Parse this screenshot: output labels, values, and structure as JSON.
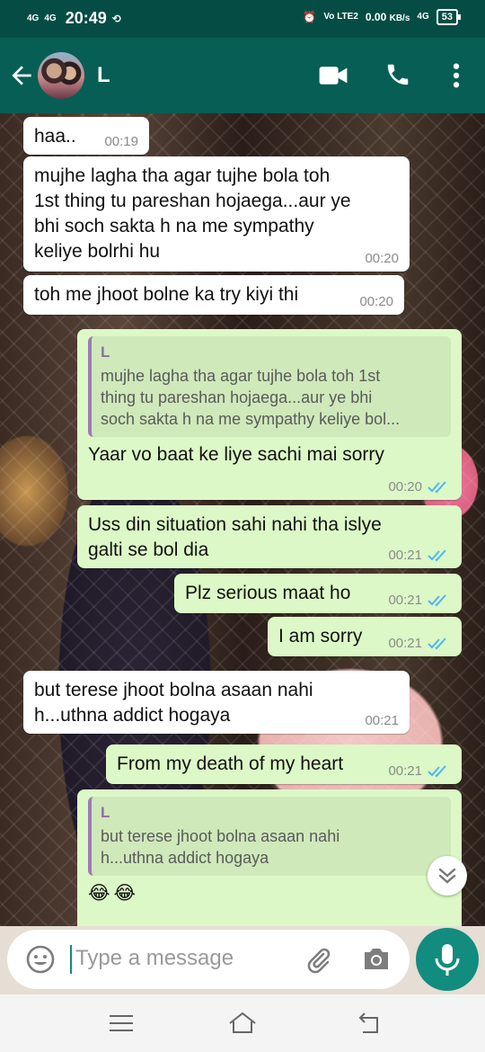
{
  "status_bar": {
    "network_left": "4G",
    "network_left2": "4G",
    "time": "20:49",
    "data_speed": "0.00",
    "data_unit": "KB/s",
    "volte": "Vo LTE2",
    "network_right": "4G",
    "battery": "53"
  },
  "header": {
    "contact_name": "L"
  },
  "messages": [
    {
      "direction": "in",
      "text": "haa..",
      "time": "00:19"
    },
    {
      "direction": "in",
      "text": "mujhe lagha tha agar tujhe bola toh\n1st thing tu pareshan hojaega...aur ye\nbhi soch sakta h na me sympathy\nkeliye bolrhi hu",
      "time": "00:20"
    },
    {
      "direction": "in",
      "text": "toh me jhoot bolne ka try kiyi thi",
      "time": "00:20"
    },
    {
      "direction": "out",
      "quote_name": "L",
      "quote_text": "mujhe lagha tha agar tujhe bola toh 1st\nthing tu pareshan hojaega...aur ye bhi\nsoch sakta h na me sympathy keliye bol...",
      "text": "Yaar vo baat ke liye sachi mai sorry",
      "time": "00:20"
    },
    {
      "direction": "out",
      "text": "Uss din situation sahi nahi tha islye\ngalti se bol dia",
      "time": "00:21"
    },
    {
      "direction": "out",
      "text": "Plz serious maat ho",
      "time": "00:21"
    },
    {
      "direction": "out",
      "text": "I am sorry",
      "time": "00:21"
    },
    {
      "direction": "in",
      "text": "but terese jhoot bolna asaan nahi\nh...uthna addict hogaya",
      "time": "00:21"
    },
    {
      "direction": "out",
      "text": "From my death of my heart",
      "time": "00:21"
    },
    {
      "direction": "out",
      "quote_name": "L",
      "quote_text": "but terese jhoot bolna asaan nahi\nh...uthna addict hogaya",
      "text": "😂😂",
      "time": ""
    }
  ],
  "input": {
    "placeholder": "Type a message"
  },
  "colors": {
    "header": "#075e54",
    "status_bar": "#054d44",
    "outgoing_bubble": "#dcf8c6",
    "incoming_bubble": "#ffffff",
    "accent": "#128c7e",
    "read_tick": "#4fb6ec"
  },
  "icons": [
    "back-arrow-icon",
    "video-call-icon",
    "phone-icon",
    "more-vert-icon",
    "emoji-icon",
    "attach-icon",
    "camera-icon",
    "mic-icon",
    "scroll-down-icon",
    "nav-menu-icon",
    "nav-home-icon",
    "nav-back-icon"
  ]
}
